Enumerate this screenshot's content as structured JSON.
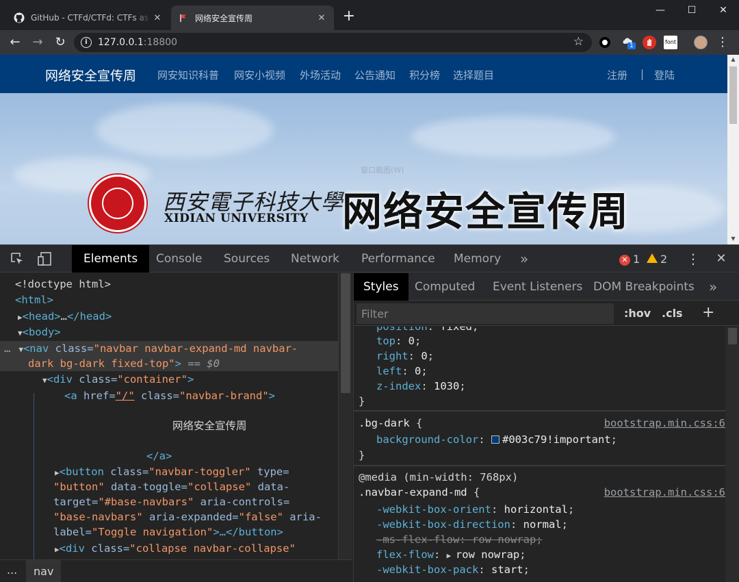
{
  "browser": {
    "tabs": [
      {
        "title": "GitHub - CTFd/CTFd: CTFs as y",
        "close": "✕"
      },
      {
        "title": "网络安全宣传周",
        "close": "✕"
      }
    ],
    "new_tab": "+",
    "window_controls": {
      "minimize": "—",
      "maximize": "☐",
      "close": "✕"
    },
    "nav": {
      "back": "←",
      "forward": "→",
      "reload": "↻"
    },
    "url_host": "127.0.0.1",
    "url_port": ":18800",
    "bookmark_star": "☆",
    "ext_badge": "1",
    "ext_font_label": "font",
    "menu": "⋮"
  },
  "site": {
    "brand": "网络安全宣传周",
    "links": [
      "网安知识科普",
      "网安小视频",
      "外场活动",
      "公告通知",
      "积分榜",
      "选择题目"
    ],
    "register": "注册",
    "separator": "|",
    "login": "登陆",
    "hero_school_cn": "西安電子科技大學",
    "hero_school_en": "XIDIAN UNIVERSITY",
    "hero_title": "网络安全宣传周",
    "hero_watermark": "窗口截图(W)"
  },
  "devtools": {
    "tabs": [
      "Elements",
      "Console",
      "Sources",
      "Network",
      "Performance",
      "Memory"
    ],
    "more": "»",
    "errors": "1",
    "warnings": "2",
    "kebab": "⋮",
    "close": "✕",
    "dom": {
      "l1": "<!doctype html>",
      "html_tag": "<html>",
      "head_open": "<head>",
      "head_ellipsis": "…",
      "head_close": "</head>",
      "body_tag": "<body>",
      "sel_dots": "…",
      "nav_open": "<nav",
      "nav_class_attr": " class=",
      "nav_class_val1": "\"navbar navbar-expand-md navbar-",
      "nav_class_val2": "dark bg-dark fixed-top\"",
      "nav_gt": ">",
      "nav_eq": " == $0",
      "div_open": "<div",
      "div_class_attr": " class=",
      "div_class_val": "\"container\"",
      "div_gt": ">",
      "a_open": "<a",
      "a_href_attr": " href=",
      "a_href_val": "\"/\"",
      "a_class_attr": " class=",
      "a_class_val": "\"navbar-brand\"",
      "a_gt": ">",
      "brand_text": "网络安全宣传周",
      "a_close": "</a>",
      "btn_open": "<button",
      "btn_class_attr": " class=",
      "btn_class_val": "\"navbar-toggler\"",
      "btn_type_attr": " type=",
      "btn_type_val": "\"button\"",
      "btn_dt_attr": " data-toggle=",
      "btn_dt_val": "\"collapse\"",
      "btn_data": " data-",
      "btn_target_attr": "target=",
      "btn_target_val": "\"#base-navbars\"",
      "btn_ac_attr": " aria-controls=",
      "btn_ac_val": "\"base-navbars\"",
      "btn_ae_attr": " aria-expanded=",
      "btn_ae_val": "\"false\"",
      "btn_aria": " aria-",
      "btn_label_attr": "label=",
      "btn_label_val": "\"Toggle navigation\"",
      "btn_tail": ">…",
      "btn_close": "</button>",
      "div2_open": "<div",
      "div2_class_attr": " class=",
      "div2_class_val": "\"collapse navbar-collapse\""
    },
    "breadcrumb_dots": "...",
    "breadcrumb_node": "nav",
    "styles": {
      "tabs": [
        "Styles",
        "Computed",
        "Event Listeners",
        "DOM Breakpoints"
      ],
      "more": "»",
      "filter_placeholder": "Filter",
      "hov": ":hov",
      "cls": ".cls",
      "plus": "+",
      "rule1": [
        {
          "prop": "position",
          "val": "fixed"
        },
        {
          "prop": "top",
          "val": "0"
        },
        {
          "prop": "right",
          "val": "0"
        },
        {
          "prop": "left",
          "val": "0"
        },
        {
          "prop": "z-index",
          "val": "1030"
        }
      ],
      "close_brace": "}",
      "open_brace": "{",
      "colon": ": ",
      "semicolon": ";",
      "rule2_selector": ".bg-dark",
      "rule2_source": "bootstrap.min.css:6",
      "rule2_prop": "background-color",
      "rule2_val": "#003c79!important",
      "swatch_color": "#003c79",
      "media": "@media (min-width: 768px)",
      "rule3_selector": ".navbar-expand-md",
      "rule3_source": "bootstrap.min.css:6",
      "rule3": [
        {
          "prop": "-webkit-box-orient",
          "val": "horizontal"
        },
        {
          "prop": "-webkit-box-direction",
          "val": "normal"
        },
        {
          "prop": "-ms-flex-flow",
          "val": "row nowrap"
        },
        {
          "prop": "flex-flow",
          "val": "row nowrap"
        },
        {
          "prop": "-webkit-box-pack",
          "val": "start"
        }
      ]
    }
  }
}
